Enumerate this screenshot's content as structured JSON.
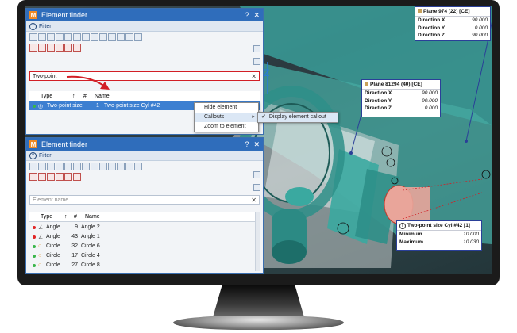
{
  "finder1": {
    "title": "Element finder",
    "help": "?",
    "close": "✕",
    "filter_label": "Filter",
    "search_value": "Two-point",
    "clear": "✕",
    "columns": {
      "type": "Type",
      "sort": "↑",
      "num": "#",
      "name": "Name"
    },
    "rows": [
      {
        "type": "Two-point size",
        "num": "1",
        "name": "Two-point size Cyl #42",
        "dot": "#39b54a"
      }
    ]
  },
  "context_menu": {
    "items": [
      "Hide element",
      "Callouts",
      "Zoom to element"
    ],
    "submenu_arrow": "▸",
    "submenu_check": "✔",
    "submenu_item": "Display element callout"
  },
  "finder2": {
    "title": "Element finder",
    "help": "?",
    "close": "✕",
    "filter_label": "Filter",
    "search_placeholder": "Element name...",
    "clear": "✕",
    "columns": {
      "type": "Type",
      "sort": "↑",
      "num": "#",
      "name": "Name"
    },
    "rows": [
      {
        "type": "Angle",
        "num": "9",
        "name": "Angle 2",
        "dot": "#e02424",
        "icon": "angle"
      },
      {
        "type": "Angle",
        "num": "43",
        "name": "Angle 1",
        "dot": "#e02424",
        "icon": "angle"
      },
      {
        "type": "Circle",
        "num": "32",
        "name": "Circle 6",
        "dot": "#39b54a",
        "icon": "circle"
      },
      {
        "type": "Circle",
        "num": "17",
        "name": "Circle 4",
        "dot": "#39b54a",
        "icon": "circle"
      },
      {
        "type": "Circle",
        "num": "27",
        "name": "Circle 8",
        "dot": "#39b54a",
        "icon": "circle"
      }
    ]
  },
  "callouts": {
    "plane974": {
      "title": "Plane 974 (22) [CE]",
      "rows": [
        {
          "label": "Direction X",
          "value": "90.000"
        },
        {
          "label": "Direction Y",
          "value": "0.000"
        },
        {
          "label": "Direction Z",
          "value": "90.000"
        }
      ]
    },
    "plane81294": {
      "title": "Plane 81294 (40) [CE]",
      "rows": [
        {
          "label": "Direction X",
          "value": "90.000"
        },
        {
          "label": "Direction Y",
          "value": "90.000"
        },
        {
          "label": "Direction Z",
          "value": "0.000"
        }
      ]
    },
    "twopoint": {
      "title": "Two-point size Cyl #42 [1]",
      "rows": [
        {
          "label": "Minimum",
          "value": "10.000"
        },
        {
          "label": "Maximum",
          "value": "10.030"
        }
      ]
    }
  },
  "colors": {
    "accent": "#2f6dbb",
    "highlight": "#d21f26",
    "callout_border": "#2a3f98",
    "model": "#3aa9a0"
  }
}
